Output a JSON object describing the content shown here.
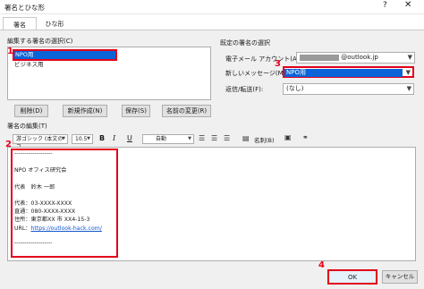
{
  "window": {
    "title": "署名とひな形",
    "help": "?",
    "close": "✕"
  },
  "tabs": [
    "署名",
    "ひな形"
  ],
  "left": {
    "select_label": "編集する署名の選択(C)",
    "items": [
      "NPO用",
      "ビジネス用"
    ],
    "buttons": [
      "削除(D)",
      "新規作成(N)",
      "保存(S)",
      "名前の変更(R)"
    ]
  },
  "right": {
    "group_label": "既定の署名の選択",
    "account_label": "電子メール アカウント(A):",
    "account_value": "@outlook.jp",
    "new_msg_label": "新しいメッセージ(M):",
    "new_msg_value": "NPO用",
    "reply_label": "返信/転送(F):",
    "reply_value": "(なし)"
  },
  "editor": {
    "label": "署名の編集(T)",
    "font": "游ゴシック (本文のフ",
    "size": "10.5",
    "bold": "B",
    "italic": "I",
    "underline": "U",
    "color": "自動",
    "business_card": "名刺(B)",
    "lines": [
      "-------------------",
      "NPO オフィス研究会",
      "代表　鈴木 一郎",
      "代表：03-XXXX-XXXX",
      "直通：080-XXXX-XXXX",
      "住所：東京都XX 市 XX4-15-3",
      "https://outlook-hack.com/",
      "-------------------"
    ],
    "url_prefix": "URL："
  },
  "footer": {
    "ok": "OK",
    "cancel": "キャンセル"
  },
  "badges": [
    "1",
    "2",
    "3",
    "4"
  ],
  "colors": {
    "highlight": "#0a64d8",
    "annotation": "#e2001a"
  }
}
